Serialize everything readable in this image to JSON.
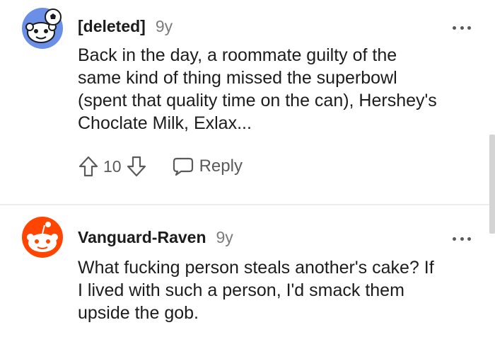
{
  "comments": [
    {
      "username": "[deleted]",
      "age": "9y",
      "body": "Back in the day, a roommate guilty of the\nsame kind of thing missed the superbowl\n(spent that quality time on the can), Hershey's\nChoclate Milk, Exlax...",
      "score": "10",
      "reply_label": "Reply"
    },
    {
      "username": "Vanguard-Raven",
      "age": "9y",
      "body": "What fucking person steals another's cake? If\nI lived with such a person, I'd smack them\nupside the gob."
    }
  ],
  "colors": {
    "avatar_blue": "#6b8fe6",
    "avatar_orange": "#ff4500",
    "text_muted": "#7c7c7c"
  }
}
